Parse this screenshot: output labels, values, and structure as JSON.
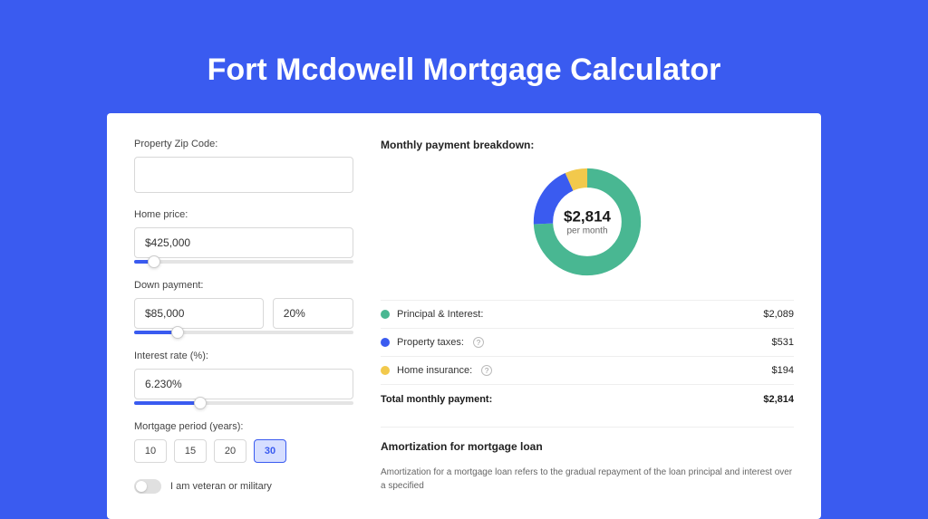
{
  "page_title": "Fort Mcdowell Mortgage Calculator",
  "form": {
    "zip": {
      "label": "Property Zip Code:",
      "value": ""
    },
    "price": {
      "label": "Home price:",
      "value": "$425,000",
      "slider_pct": 9
    },
    "down": {
      "label": "Down payment:",
      "amount": "$85,000",
      "pct": "20%",
      "slider_pct": 20
    },
    "rate": {
      "label": "Interest rate (%):",
      "value": "6.230%",
      "slider_pct": 30
    },
    "period": {
      "label": "Mortgage period (years):",
      "options": [
        "10",
        "15",
        "20",
        "30"
      ],
      "selected": "30"
    },
    "veteran": {
      "label": "I am veteran or military",
      "on": false
    }
  },
  "breakdown": {
    "title": "Monthly payment breakdown:",
    "center_amount": "$2,814",
    "center_sub": "per month",
    "items": [
      {
        "label": "Principal & Interest:",
        "amount": "$2,089",
        "color": "#49b792",
        "pct": 74.2
      },
      {
        "label": "Property taxes:",
        "amount": "$531",
        "color": "#3a5bf0",
        "pct": 18.9,
        "info": true
      },
      {
        "label": "Home insurance:",
        "amount": "$194",
        "color": "#f2c94c",
        "pct": 6.9,
        "info": true
      }
    ],
    "total_label": "Total monthly payment:",
    "total_amount": "$2,814"
  },
  "amort": {
    "title": "Amortization for mortgage loan",
    "text": "Amortization for a mortgage loan refers to the gradual repayment of the loan principal and interest over a specified"
  },
  "chart_data": {
    "type": "pie",
    "title": "Monthly payment breakdown",
    "categories": [
      "Principal & Interest",
      "Property taxes",
      "Home insurance"
    ],
    "values": [
      2089,
      531,
      194
    ],
    "total": 2814,
    "unit": "USD per month",
    "colors": [
      "#49b792",
      "#3a5bf0",
      "#f2c94c"
    ]
  }
}
